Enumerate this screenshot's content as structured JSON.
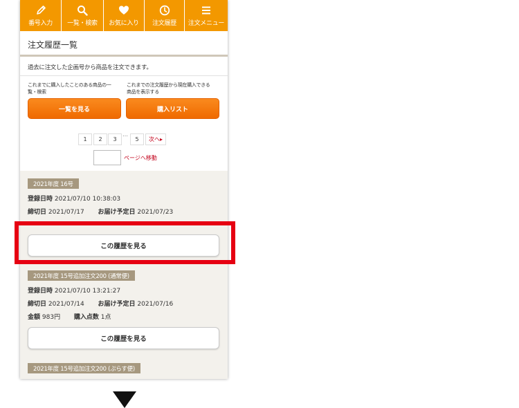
{
  "nav": {
    "items": [
      {
        "label": "番号入力",
        "icon": "pencil-icon"
      },
      {
        "label": "一覧・検索",
        "icon": "search-icon"
      },
      {
        "label": "お気に入り",
        "icon": "heart-icon"
      },
      {
        "label": "注文履歴",
        "icon": "clock-icon"
      },
      {
        "label": "注文メニュー",
        "icon": "menu-icon"
      }
    ]
  },
  "page": {
    "title": "注文履歴一覧",
    "description": "過去に注文した企画号から商品を注文できます。"
  },
  "actions": {
    "list_note_line1": "これまでに購入したことのある商品の一",
    "list_note_line2": "覧・検索",
    "list_button": "一覧を見る",
    "purchase_note_line1": "これまでの注文履歴から現在購入できる",
    "purchase_note_line2": "商品を表示する",
    "purchase_button": "購入リスト"
  },
  "pagination": {
    "pages": [
      "1",
      "2",
      "3",
      "5"
    ],
    "ellipsis": "…",
    "next": "次へ▸",
    "jump_label": "ページへ移動"
  },
  "history": {
    "labels": {
      "registered": "登録日時",
      "deadline": "締切日",
      "delivery": "お届け予定日",
      "amount": "金額",
      "count": "購入点数",
      "view_button": "この履歴を見る"
    },
    "entries": [
      {
        "title": "2021年度 16号",
        "registered": "2021/07/10 10:38:03",
        "deadline": "2021/07/17",
        "delivery": "2021/07/23"
      },
      {
        "title": "2021年度 15号追加注文200 (通常便)",
        "registered": "2021/07/10 13:21:27",
        "deadline": "2021/07/14",
        "delivery": "2021/07/16",
        "amount": "983円",
        "count": "1点"
      },
      {
        "title": "2021年度 15号追加注文200 (ぷらす便)"
      }
    ]
  },
  "colors": {
    "nav_orange": "#f39800",
    "button_orange": "#ef6a00",
    "tag_brown": "#a6987f",
    "highlight_red": "#e60012",
    "link_red": "#c2001a"
  }
}
